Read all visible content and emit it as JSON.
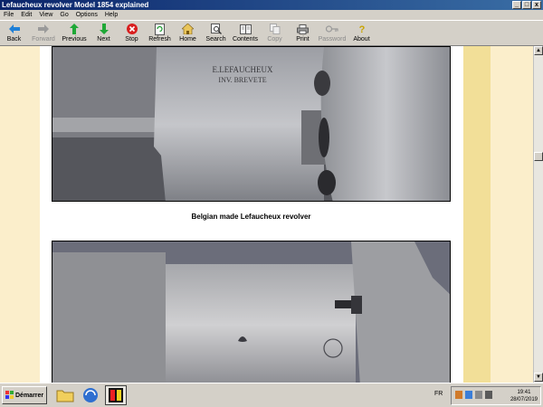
{
  "window": {
    "title": "Lefaucheux revolver Model 1854 explained",
    "buttons": {
      "minimize": "_",
      "maximize": "□",
      "close": "x"
    }
  },
  "menu": [
    "File",
    "Edit",
    "View",
    "Go",
    "Options",
    "Help"
  ],
  "toolbar": {
    "back": "Back",
    "forward": "Forward",
    "previous": "Previous",
    "next": "Next",
    "stop": "Stop",
    "refresh": "Refresh",
    "home": "Home",
    "search": "Search",
    "contents": "Contents",
    "copy": "Copy",
    "print": "Print",
    "password": "Password",
    "about": "About"
  },
  "icons": {
    "back": "left-arrow-icon",
    "forward": "right-arrow-icon",
    "previous": "up-arrow-icon",
    "next": "down-arrow-icon",
    "stop": "stop-icon",
    "refresh": "refresh-icon",
    "home": "house-icon",
    "search": "magnifier-icon",
    "contents": "book-icon",
    "copy": "copy-icon",
    "print": "printer-icon",
    "password": "key-icon",
    "about": "question-icon"
  },
  "content": {
    "photo1_marking_line1": "E.LEFAUCHEUX",
    "photo1_marking_line2": "INV. BREVETE",
    "caption1": "Belgian made Lefaucheux revolver"
  },
  "taskbar": {
    "start": "Démarrer",
    "language": "FR",
    "time": "19:41",
    "date": "28/07/2019"
  },
  "colors": {
    "title_bar": "#0a246a",
    "band_left": "#fbeecb",
    "band_right": "#f2df98"
  }
}
